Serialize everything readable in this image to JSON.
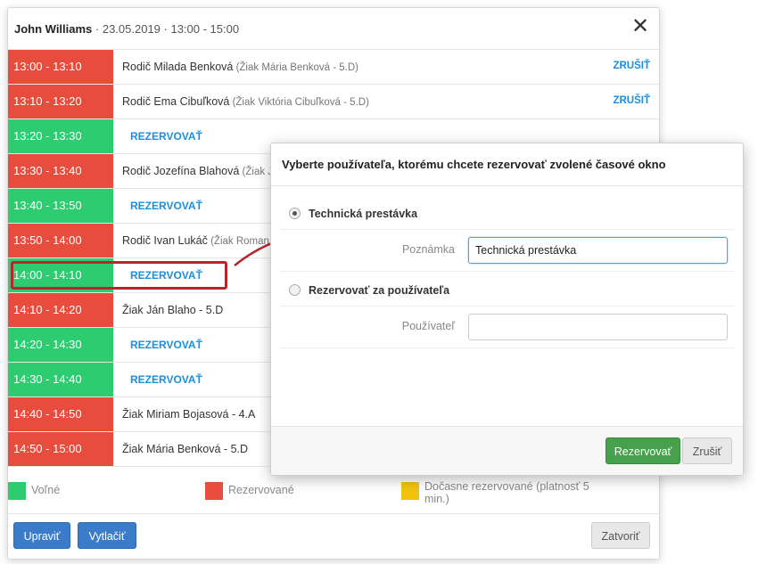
{
  "window": {
    "title_name": "John Williams",
    "title_meta": " · 23.05.2019 · 13:00 - 15:00",
    "close_glyph": "✕"
  },
  "slots": [
    {
      "time": "13:00 - 13:10",
      "status": "busy",
      "desc": "Rodič Milada Benková",
      "note": " (Žiak Mária Benková - 5.D)",
      "cancel": "ZRUŠIŤ"
    },
    {
      "time": "13:10 - 13:20",
      "status": "busy",
      "desc": "Rodič Ema Cibuľková",
      "note": " (Žiak Viktória Cibuľková - 5.D)",
      "cancel": "ZRUŠIŤ"
    },
    {
      "time": "13:20 - 13:30",
      "status": "free",
      "reserve": "REZERVOVAŤ"
    },
    {
      "time": "13:30 - 13:40",
      "status": "busy",
      "desc": "Rodič Jozefína Blahová",
      "note": " (Žiak J"
    },
    {
      "time": "13:40 - 13:50",
      "status": "free",
      "reserve": "REZERVOVAŤ"
    },
    {
      "time": "13:50 - 14:00",
      "status": "busy",
      "desc": "Rodič Ivan Lukáč",
      "note": " (Žiak Roman"
    },
    {
      "time": "14:00 - 14:10",
      "status": "free",
      "reserve": "REZERVOVAŤ"
    },
    {
      "time": "14:10 - 14:20",
      "status": "busy",
      "desc": "Žiak Ján Blaho - 5.D"
    },
    {
      "time": "14:20 - 14:30",
      "status": "free",
      "reserve": "REZERVOVAŤ"
    },
    {
      "time": "14:30 - 14:40",
      "status": "free",
      "reserve": "REZERVOVAŤ"
    },
    {
      "time": "14:40 - 14:50",
      "status": "busy",
      "desc": "Žiak Miriam Bojasová - 4.A"
    },
    {
      "time": "14:50 - 15:00",
      "status": "busy",
      "desc": "Žiak Mária Benková - 5.D"
    }
  ],
  "legend": {
    "free_label": "Voľné",
    "reserved_label": "Rezervované",
    "temp_label": "Dočasne rezervované (platnosť 5 min.)",
    "colors": {
      "free": "#2ecc71",
      "reserved": "#e84c3d",
      "temp": "#f1c40f"
    }
  },
  "footer": {
    "edit_label": "Upraviť",
    "print_label": "Vytlačiť",
    "close_label": "Zatvoriť"
  },
  "modal": {
    "title": "Vyberte používateľa, ktorému chcete rezervovať zvolené časové okno",
    "option_break_label": "Technická prestávka",
    "note_label": "Poznámka",
    "note_value": "Technická prestávka",
    "option_user_label": "Rezervovať za používateľa",
    "user_label": "Používateľ",
    "user_value": "",
    "reserve_button": "Rezervovať",
    "cancel_button": "Zrušiť"
  }
}
